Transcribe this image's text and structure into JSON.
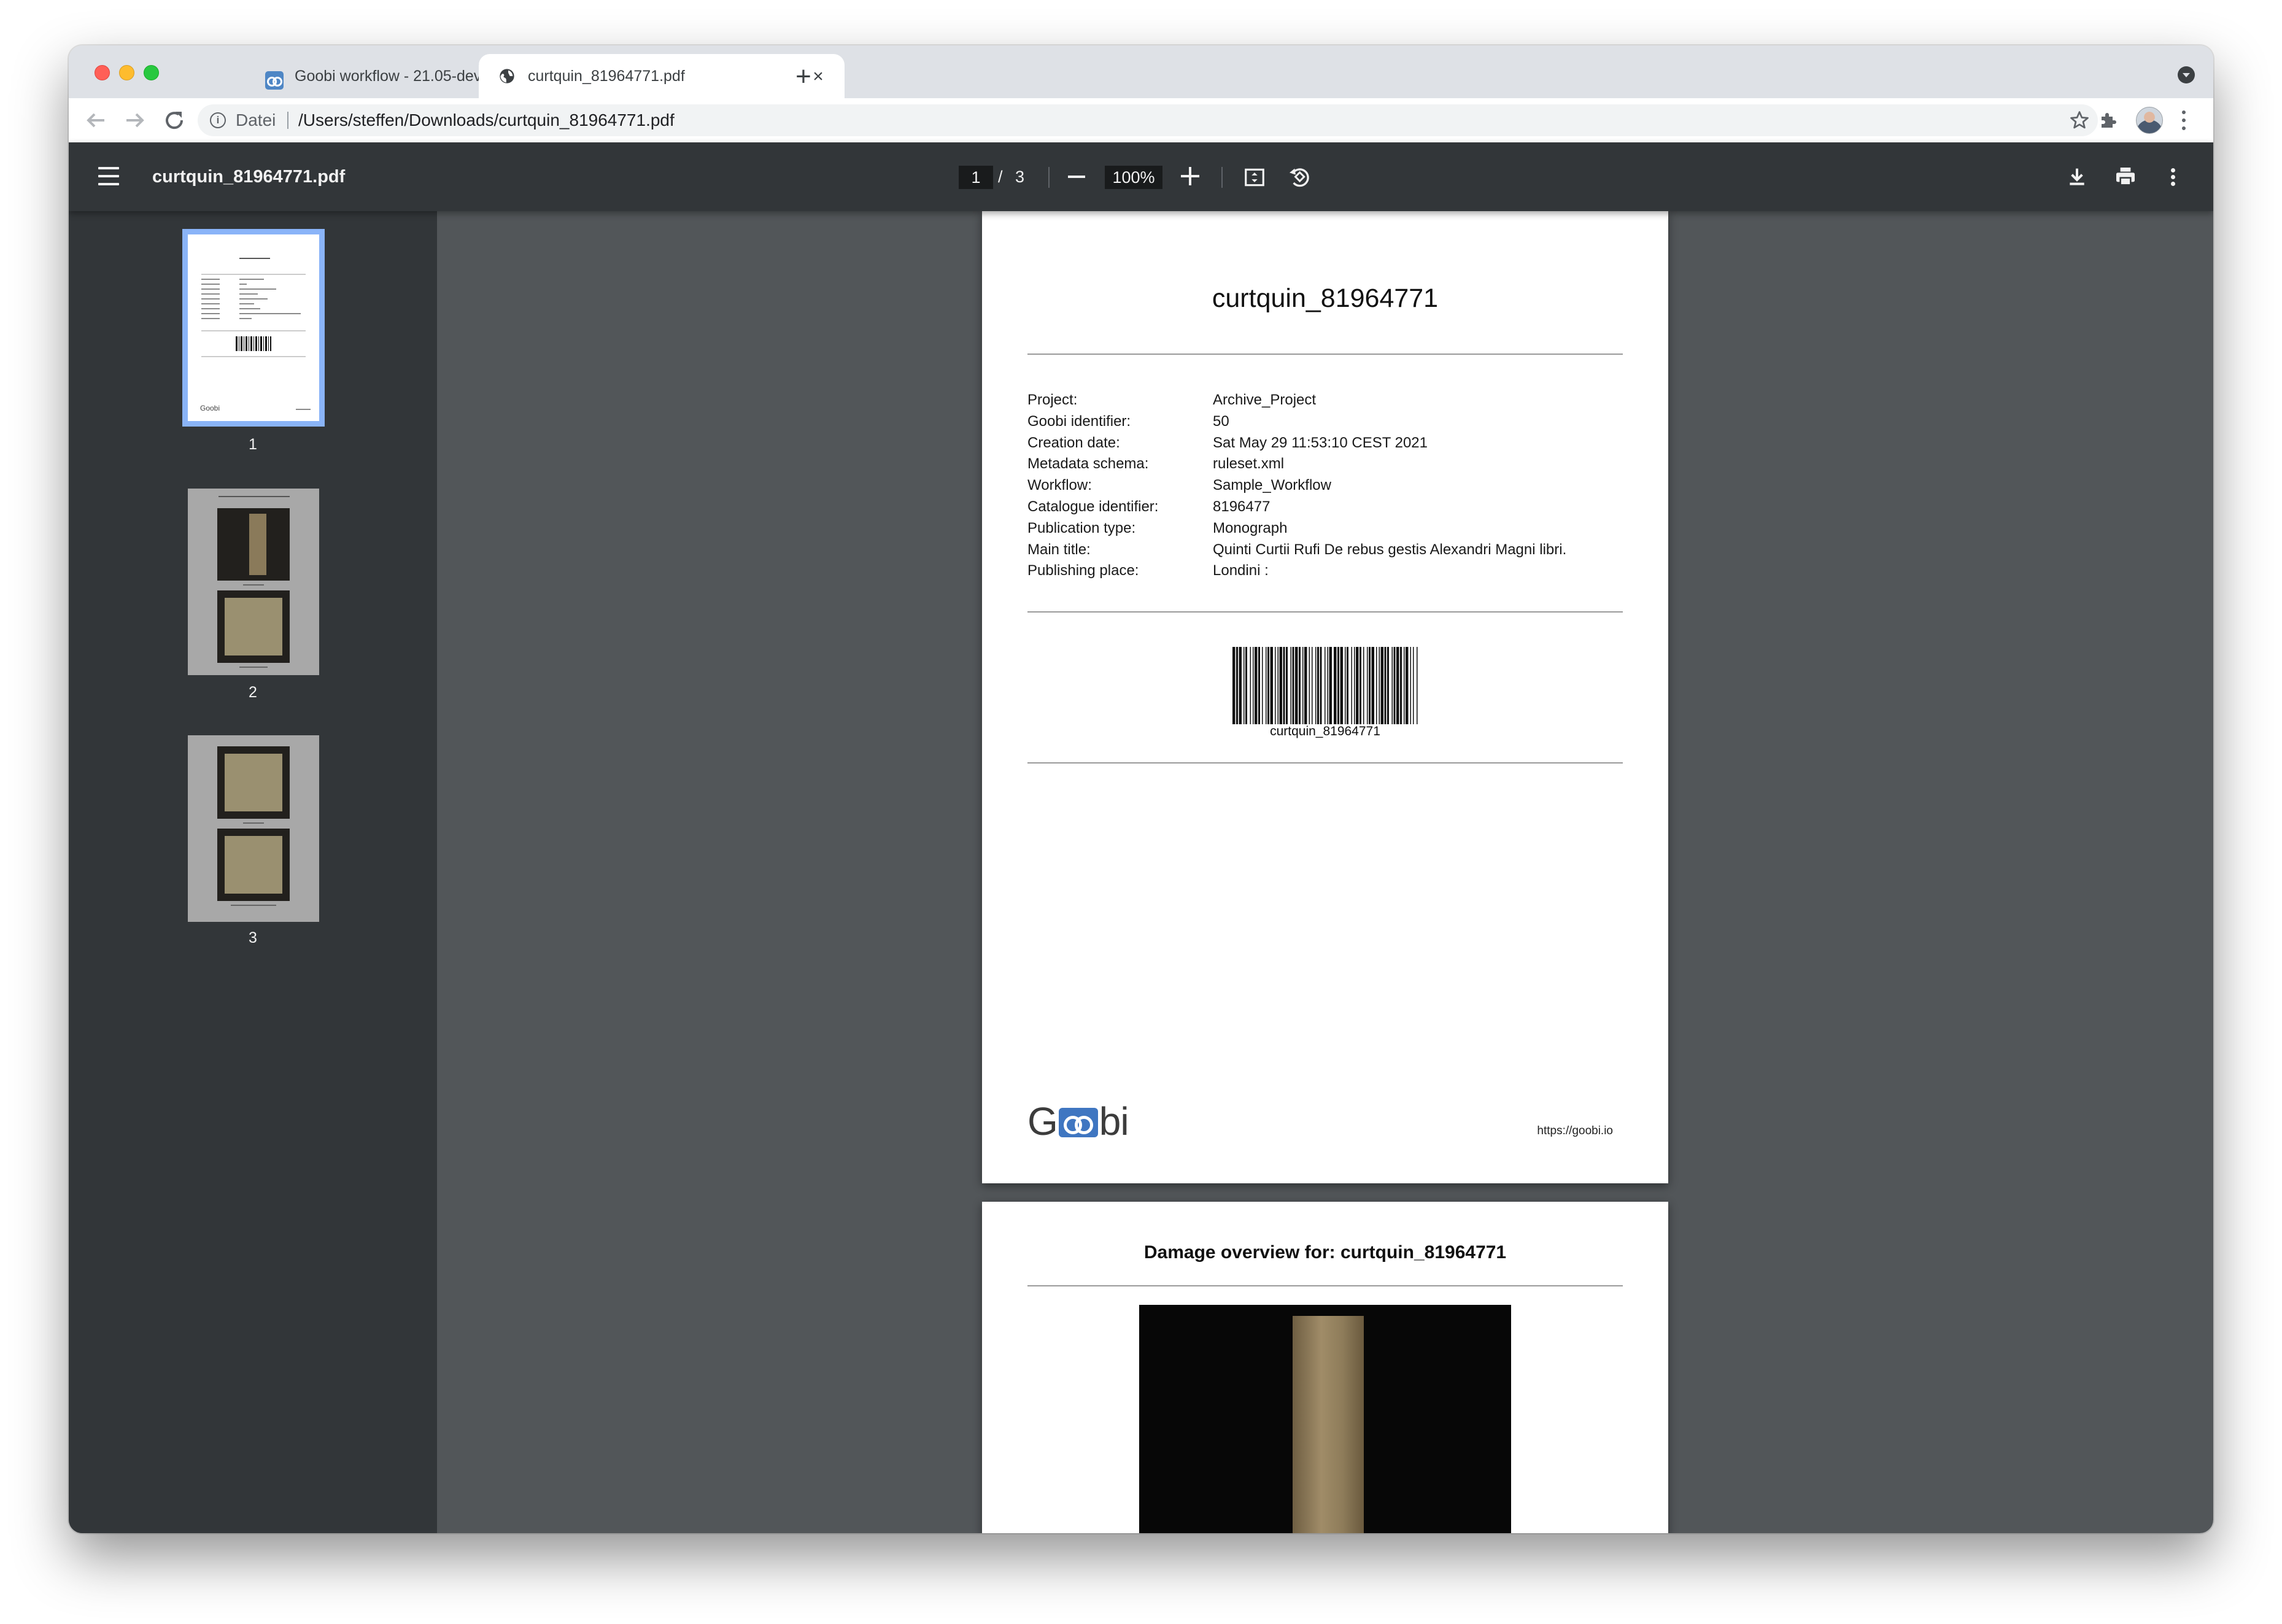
{
  "browser": {
    "tabs": [
      {
        "title": "Goobi workflow - 21.05-dev",
        "active": false
      },
      {
        "title": "curtquin_81964771.pdf",
        "active": true
      }
    ],
    "address": {
      "scheme_label": "Datei",
      "url": "/Users/steffen/Downloads/curtquin_81964771.pdf"
    }
  },
  "pdf_toolbar": {
    "filename": "curtquin_81964771.pdf",
    "current_page": "1",
    "separator": "/",
    "total_pages": "3",
    "zoom": "100%"
  },
  "thumbnails": [
    {
      "number": "1",
      "selected": true
    },
    {
      "number": "2",
      "selected": false
    },
    {
      "number": "3",
      "selected": false
    }
  ],
  "page1": {
    "title": "curtquin_81964771",
    "metadata": [
      {
        "key": "Project:",
        "value": "Archive_Project"
      },
      {
        "key": "Goobi identifier:",
        "value": "50"
      },
      {
        "key": "Creation date:",
        "value": "Sat May 29 11:53:10 CEST 2021"
      },
      {
        "key": "Metadata schema:",
        "value": "ruleset.xml"
      },
      {
        "key": "Workflow:",
        "value": "Sample_Workflow"
      },
      {
        "key": "Catalogue identifier:",
        "value": "8196477"
      },
      {
        "key": "Publication type:",
        "value": "Monograph"
      },
      {
        "key": "Main title:",
        "value": "Quinti Curtii Rufi De rebus gestis Alexandri Magni libri."
      },
      {
        "key": "Publishing place:",
        "value": "Londini :"
      }
    ],
    "barcode_label": "curtquin_81964771",
    "logo": {
      "text_start": "G",
      "text_end": "bi",
      "color": "#3f76c1"
    },
    "url": "https://goobi.io"
  },
  "page2": {
    "title": "Damage overview for: curtquin_81964771"
  },
  "colors": {
    "accent_selected": "#8ab4f8",
    "pdf_toolbar_bg": "#323639",
    "viewer_bg": "#525659",
    "tab_strip_bg": "#dee1e6"
  }
}
